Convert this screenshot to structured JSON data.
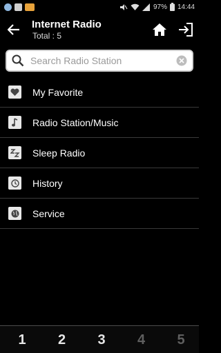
{
  "status_bar": {
    "battery": "97%",
    "time": "14:44"
  },
  "header": {
    "title": "Internet Radio",
    "subtitle": "Total : 5"
  },
  "search": {
    "placeholder": "Search Radio Station"
  },
  "menu": {
    "items": [
      {
        "label": "My Favorite",
        "icon": "heart-icon"
      },
      {
        "label": "Radio Station/Music",
        "icon": "music-note-icon"
      },
      {
        "label": "Sleep Radio",
        "icon": "sleep-zz-icon"
      },
      {
        "label": "History",
        "icon": "history-clock-icon"
      },
      {
        "label": "Service",
        "icon": "globe-icon"
      }
    ]
  },
  "pagination": {
    "pages": [
      "1",
      "2",
      "3",
      "4",
      "5"
    ],
    "active_pages": [
      "1",
      "2",
      "3"
    ]
  },
  "colors": {
    "background": "#000000",
    "divider": "#3a3a3a",
    "inactive_page": "#5f5f5f"
  }
}
